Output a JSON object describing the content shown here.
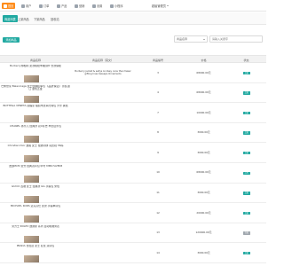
{
  "topnav": {
    "items": [
      {
        "label": "首页",
        "icon": "home-icon",
        "active": true
      },
      {
        "label": "用户",
        "icon": "user-icon",
        "active": false
      },
      {
        "label": "订单",
        "icon": "order-icon",
        "active": false
      },
      {
        "label": "产品",
        "icon": "product-icon",
        "active": false
      },
      {
        "label": "营销",
        "icon": "marketing-icon",
        "active": false
      },
      {
        "label": "设置",
        "icon": "gear-icon",
        "active": false
      },
      {
        "label": "小程序",
        "icon": "miniprogram-icon",
        "active": false
      }
    ],
    "user_menu": "超级管理员"
  },
  "tabs": [
    {
      "label": "商品列表",
      "active": true
    },
    {
      "label": "上架商品",
      "active": false
    },
    {
      "label": "下架商品",
      "active": false
    },
    {
      "label": "回收站",
      "active": false
    }
  ],
  "toolbar": {
    "add_label": "添加商品",
    "select_value": "商品名称",
    "search_placeholder": "请输入关键字"
  },
  "table": {
    "headers": [
      "商品名称",
      "商品名称（英文）",
      "商品编号",
      "价格",
      "状态"
    ],
    "rows": [
      {
        "name": "Burberry博柏利 女款格纹羊绒围巾 长款保暖",
        "attr": "Burberry jacket & swtys Lindsey cans then fewer gifting lines Sweeps Ornaments",
        "code": "3",
        "price": "68000.00元",
        "status": "上架"
      },
      {
        "name": "巴黎世家 Balenciaga 女士经典机车包 【品质保证】 原装进口 金色五金",
        "attr": "",
        "code": "4",
        "price": "68000.00元",
        "status": "上架"
      },
      {
        "name": "BOTTEGA VENETA 葆蝶家 编织羊皮革托特包 大号 黑色",
        "attr": "",
        "code": "7",
        "price": "10000.00元",
        "status": "上架"
      },
      {
        "name": "CHANEL 香奈儿 经典款 双C标志 羊皮链条包",
        "attr": "",
        "code": "8",
        "price": "3000.00元",
        "status": "上架"
      },
      {
        "name": "Christian Dior 迪奥 女士 蜜蜂刺绣 真皮鞋 36码",
        "attr": "",
        "code": "9",
        "price": "3000.00元",
        "status": "上架"
      },
      {
        "name": "法国MCM 女式 经典双肩包 中号 MMK7AVE08",
        "attr": "",
        "code": "10",
        "price": "68000.00元",
        "status": "上架"
      },
      {
        "name": "GUCCI 古驰 女士 经典款 GG 手提包 米色",
        "attr": "",
        "code": "11",
        "price": "3000.00元",
        "status": "上架"
      },
      {
        "name": "MICHAEL KORS 迈克高仕 女款 手提单肩包",
        "attr": "",
        "code": "12",
        "price": "20000.00元",
        "status": "上架"
      },
      {
        "name": "劳力士 ROLEX 迪通拿 系列 自动机械男表",
        "attr": "",
        "code": "13",
        "price": "120000.00元",
        "status": "下架"
      },
      {
        "name": "PRADA 普拉达 女士 尼龙 双肩包",
        "attr": "",
        "code": "14",
        "price": "3000.00元",
        "status": "上架"
      }
    ]
  },
  "colors": {
    "accent": "#21a9a1",
    "nav_active": "#ff8c1a",
    "status_off": "#a0a7ae"
  }
}
